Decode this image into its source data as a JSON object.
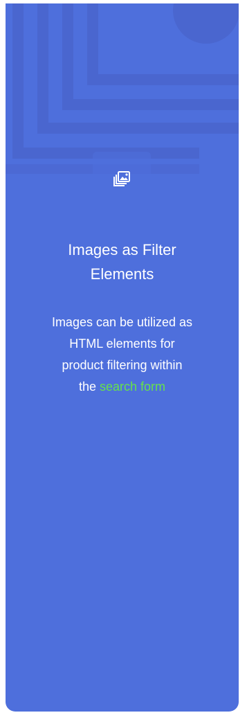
{
  "feature": {
    "icon": "images-stack-icon",
    "title_line1": "Images as Filter",
    "title_line2": "Elements",
    "desc_line1": "Images can be utilized as",
    "desc_line2": "HTML elements for",
    "desc_line3": "product filtering within",
    "desc_prefix": "the",
    "desc_link": "search form"
  },
  "colors": {
    "card_bg": "#4e6fdc",
    "link": "#66e14c",
    "text": "#ffffff"
  }
}
